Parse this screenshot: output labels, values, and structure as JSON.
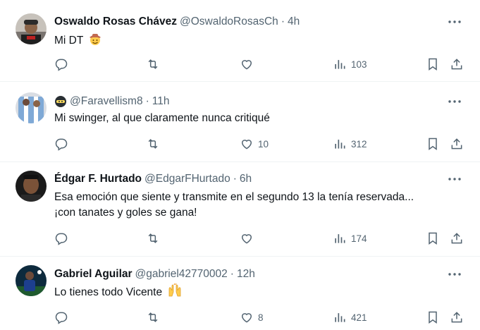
{
  "replies": [
    {
      "name": "Oswaldo Rosas Chávez",
      "handle": "@OswaldoRosasCh",
      "time": "4h",
      "text": "Mi DT",
      "emoji": "smiling-face-with-cowboy-hat",
      "comments": "",
      "retweets": "",
      "likes": "",
      "views": "103"
    },
    {
      "name": "",
      "handle": "@Faravellism8",
      "time": "11h",
      "text": "Mi swinger, al que claramente nunca critiqué",
      "name_icon": "ninja-emoji",
      "comments": "",
      "retweets": "",
      "likes": "10",
      "views": "312"
    },
    {
      "name": "Édgar F. Hurtado",
      "handle": "@EdgarFHurtado",
      "time": "6h",
      "text_line1": "Esa emoción que siente y transmite en el segundo 13 la tenía reservada...",
      "text_line2": "¡con tanates y goles se gana!",
      "comments": "",
      "retweets": "",
      "likes": "",
      "views": "174"
    },
    {
      "name": "Gabriel Aguilar",
      "handle": "@gabriel42770002",
      "time": "12h",
      "text": "Lo tienes todo Vicente",
      "emoji": "raising-hands",
      "comments": "",
      "retweets": "",
      "likes": "8",
      "views": "421"
    }
  ],
  "separator": "·",
  "icons": [
    "reply-icon",
    "retweet-icon",
    "like-icon",
    "views-icon",
    "bookmark-icon",
    "share-icon",
    "more-icon"
  ],
  "colors": {
    "text": "#0f1419",
    "secondary": "#536471",
    "border": "#eff3f4"
  }
}
